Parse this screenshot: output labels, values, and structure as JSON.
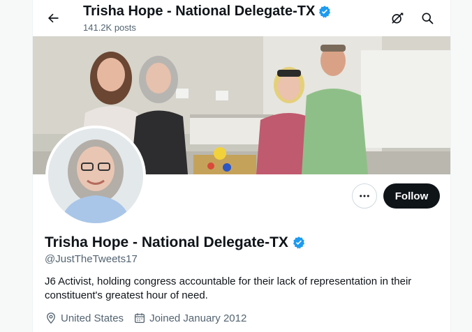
{
  "header": {
    "title": "Trisha Hope - National Delegate-TX",
    "post_count": "141.2K posts"
  },
  "profile": {
    "display_name": "Trisha Hope - National Delegate-TX",
    "handle": "@JustTheTweets17",
    "bio": "J6 Activist, holding congress accountable for their lack of representation in their constituent's greatest hour of need.",
    "location": "United States",
    "joined": "Joined January 2012",
    "verified": true
  },
  "actions": {
    "follow_label": "Follow"
  },
  "icons": {
    "back": "arrow-left-icon",
    "grok": "grok-icon",
    "search": "search-icon",
    "more": "more-horizontal-icon",
    "verified": "verified-badge-icon",
    "location": "location-pin-icon",
    "calendar": "calendar-icon"
  },
  "colors": {
    "verified": "#1d9bf0",
    "follow_bg": "#0f1419",
    "secondary_text": "#536471"
  }
}
